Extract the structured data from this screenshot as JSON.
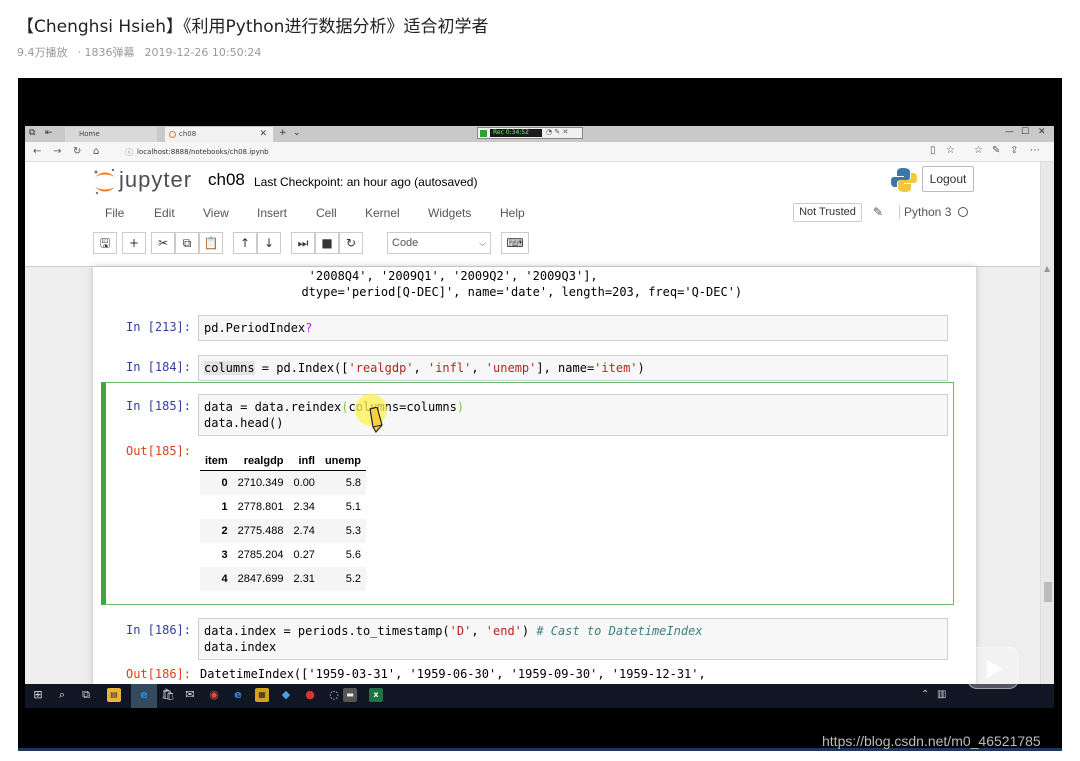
{
  "page": {
    "title": "【Chenghsi Hsieh】《利用Python进行数据分析》适合初学者",
    "views": "9.4万播放",
    "danmaku": "· 1836弹幕",
    "date": "2019-12-26 10:50:24",
    "watermark": "https://blog.csdn.net/m0_46521785"
  },
  "browser": {
    "tabs": [
      {
        "label": "Home"
      },
      {
        "label": "ch08"
      }
    ],
    "recorder_time": "Rec 0:34:52",
    "url": "localhost:8888/notebooks/ch08.ipynb"
  },
  "jupyter": {
    "logo_text": "jupyter",
    "notebook_name": "ch08",
    "checkpoint": "Last Checkpoint: an hour ago (autosaved)",
    "logout_label": "Logout",
    "menu": [
      "File",
      "Edit",
      "View",
      "Insert",
      "Cell",
      "Kernel",
      "Widgets",
      "Help"
    ],
    "not_trusted": "Not Trusted",
    "kernel_name": "Python 3",
    "cell_type": "Code"
  },
  "cells": {
    "prev_output_line1": "   '2008Q4', '2009Q1', '2009Q2', '2009Q3'],",
    "prev_output_line2": "  dtype='period[Q-DEC]', name='date', length=203, freq='Q-DEC')",
    "c213": {
      "prompt": "In [213]:",
      "code": "pd.PeriodIndex",
      "q": "?"
    },
    "c184": {
      "prompt": "In [184]:",
      "var": "columns",
      "p1": " = pd.Index([",
      "s1": "'realgdp'",
      "comma1": ", ",
      "s2": "'infl'",
      "comma2": ", ",
      "s3": "'unemp'",
      "p2": "], name=",
      "s4": "'item'",
      "p3": ")"
    },
    "c185": {
      "prompt": "In [185]:",
      "line1a": "data = data.reindex",
      "line1b": "(",
      "line1c": "columns=columns",
      "line1d": ")",
      "line2": "data.head()",
      "out_prompt": "Out[185]:"
    },
    "c186": {
      "prompt": "In [186]:",
      "line1a": "data.index = periods.to_timestamp(",
      "s1": "'D'",
      "comma": ", ",
      "s2": "'end'",
      "line1b": ") ",
      "comment": "# Cast to DatetimeIndex",
      "line2": "data.index",
      "out_prompt": "Out[186]:",
      "out_line": "DatetimeIndex(['1959-03-31', '1959-06-30', '1959-09-30', '1959-12-31',"
    }
  },
  "dataframe": {
    "columns": [
      "item",
      "realgdp",
      "infl",
      "unemp"
    ],
    "rows": [
      [
        "0",
        "2710.349",
        "0.00",
        "5.8"
      ],
      [
        "1",
        "2778.801",
        "2.34",
        "5.1"
      ],
      [
        "2",
        "2775.488",
        "2.74",
        "5.3"
      ],
      [
        "3",
        "2785.204",
        "0.27",
        "5.6"
      ],
      [
        "4",
        "2847.699",
        "2.31",
        "5.2"
      ]
    ]
  },
  "colors": {
    "jupyter_orange": "#f37726",
    "selected_cell_border": "#42a545",
    "in_prompt": "#303f9f",
    "out_prompt": "#d84315",
    "string": "#ba2121"
  }
}
